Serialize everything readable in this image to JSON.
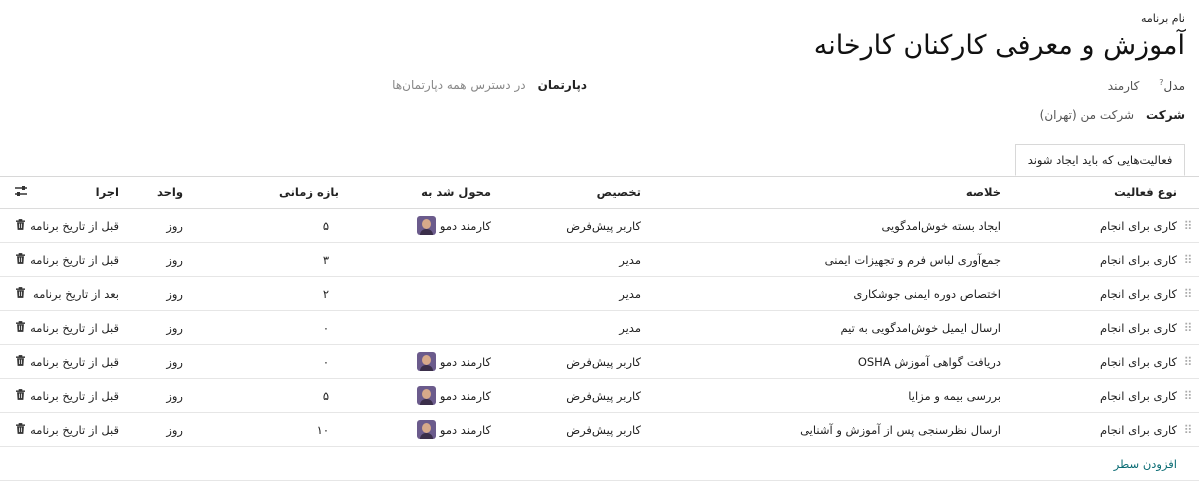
{
  "header": {
    "program_name_label": "نام برنامه",
    "program_title": "آموزش و معرفی کارکنان کارخانه"
  },
  "fields": {
    "model_label": "مدل",
    "model_help": "?",
    "model_value": "کارمند",
    "department_label": "دپارتمان",
    "department_value": "در دسترس همه دپارتمان‌ها",
    "company_label": "شرکت",
    "company_value": "شرکت من (تهران)"
  },
  "tabs": [
    {
      "label": "فعالیت‌هایی که باید ایجاد شوند"
    }
  ],
  "table": {
    "columns": {
      "activity_type": "نوع فعالیت",
      "summary": "خلاصه",
      "assignment": "تخصیص",
      "assigned_to": "محول شد به",
      "interval": "بازه زمانی",
      "unit": "واحد",
      "trigger": "اجرا"
    },
    "rows": [
      {
        "activity_type": "کاری برای انجام",
        "summary": "ایجاد بسته خوش‌امدگویی",
        "assignment": "کاربر پیش‌فرض",
        "assigned_to": "کارمند دمو",
        "interval": "۵",
        "unit": "روز",
        "trigger": "قبل از تاریخ برنامه"
      },
      {
        "activity_type": "کاری برای انجام",
        "summary": "جمع‌آوری لباس فرم و تجهیزات ایمنی",
        "assignment": "مدیر",
        "assigned_to": "",
        "interval": "۳",
        "unit": "روز",
        "trigger": "قبل از تاریخ برنامه"
      },
      {
        "activity_type": "کاری برای انجام",
        "summary": "اختصاص دوره ایمنی جوشکاری",
        "assignment": "مدیر",
        "assigned_to": "",
        "interval": "۲",
        "unit": "روز",
        "trigger": "بعد از تاریخ برنامه"
      },
      {
        "activity_type": "کاری برای انجام",
        "summary": "ارسال ایمیل خوش‌امدگویی به تیم",
        "assignment": "مدیر",
        "assigned_to": "",
        "interval": "۰",
        "unit": "روز",
        "trigger": "قبل از تاریخ برنامه"
      },
      {
        "activity_type": "کاری برای انجام",
        "summary": "دریافت گواهی آموزش OSHA",
        "assignment": "کاربر پیش‌فرض",
        "assigned_to": "کارمند دمو",
        "interval": "۰",
        "unit": "روز",
        "trigger": "قبل از تاریخ برنامه"
      },
      {
        "activity_type": "کاری برای انجام",
        "summary": "بررسی بیمه و مزایا",
        "assignment": "کاربر پیش‌فرض",
        "assigned_to": "کارمند دمو",
        "interval": "۵",
        "unit": "روز",
        "trigger": "قبل از تاریخ برنامه"
      },
      {
        "activity_type": "کاری برای انجام",
        "summary": "ارسال نظرسنجی پس از آموزش و آشنایی",
        "assignment": "کاربر پیش‌فرض",
        "assigned_to": "کارمند دمو",
        "interval": "۱۰",
        "unit": "روز",
        "trigger": "قبل از تاریخ برنامه"
      }
    ],
    "add_line": "افزودن سطر"
  },
  "icons": {
    "drag_handle": "drag-handle-icon",
    "trash": "trash-icon",
    "column_settings": "sliders-icon"
  },
  "colors": {
    "link": "#0a6c74"
  }
}
